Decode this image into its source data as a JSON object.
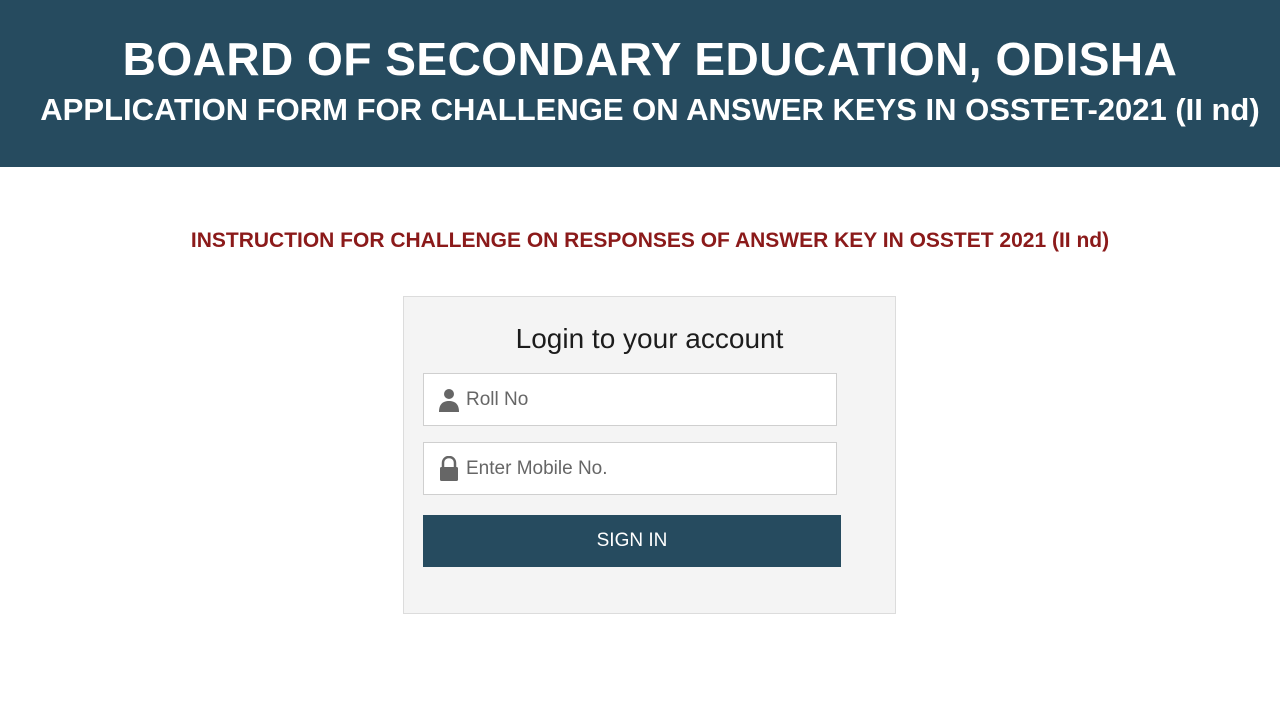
{
  "header": {
    "title": "BOARD OF SECONDARY EDUCATION, ODISHA",
    "subtitle": "APPLICATION FORM FOR CHALLENGE ON ANSWER KEYS IN OSSTET-2021 (II nd)"
  },
  "instruction": {
    "link_text": "INSTRUCTION FOR CHALLENGE ON RESPONSES OF ANSWER KEY IN OSSTET 2021 (II nd)"
  },
  "login": {
    "title": "Login to your account",
    "roll_field": {
      "icon": "user-icon",
      "placeholder": "Roll No",
      "value": ""
    },
    "mobile_field": {
      "icon": "lock-icon",
      "placeholder": "Enter Mobile No.",
      "value": ""
    },
    "signin_label": "SIGN IN"
  },
  "colors": {
    "header_bg": "#264b5f",
    "button_bg": "#264b5f",
    "instruction_text": "#8b1a1a",
    "panel_bg": "#f4f4f4"
  }
}
